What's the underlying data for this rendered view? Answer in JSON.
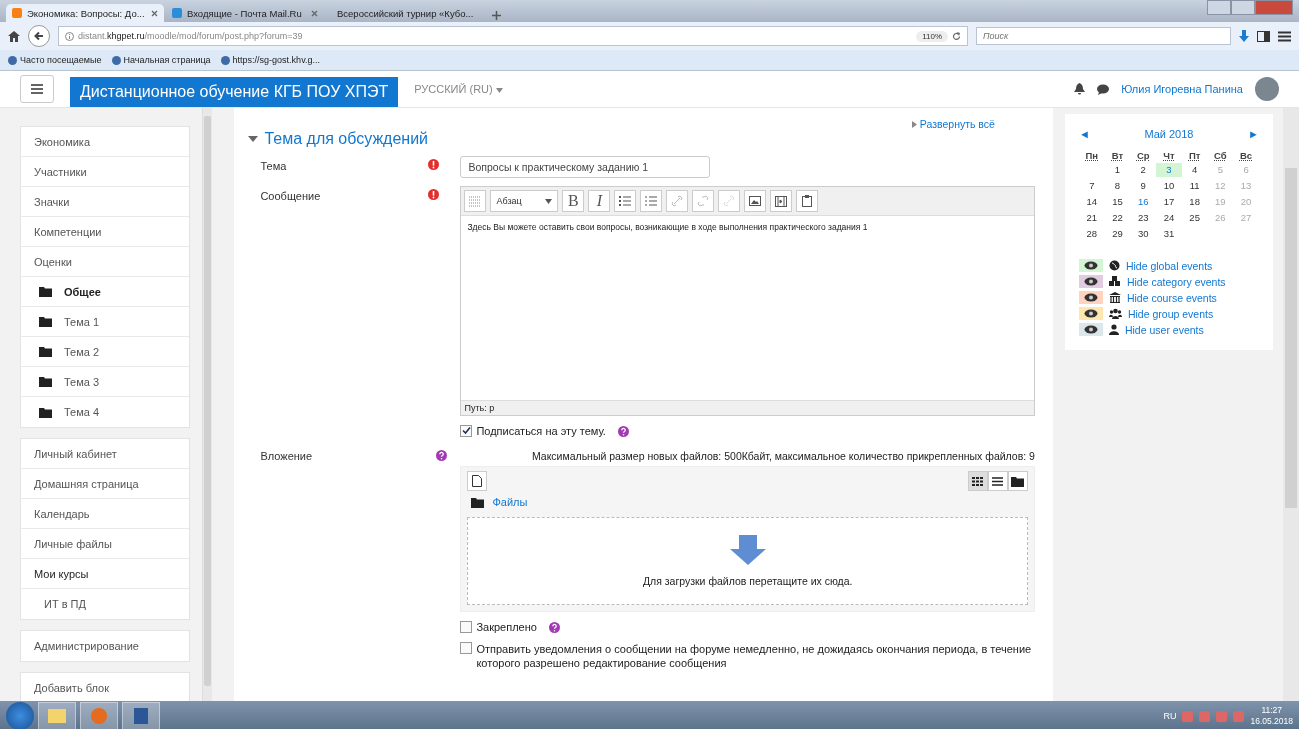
{
  "browser": {
    "tabs": [
      {
        "title": "Экономика: Вопросы: До...",
        "selected": true
      },
      {
        "title": "Входящие - Почта Mail.Ru",
        "selected": false
      },
      {
        "title": "Всероссийский турнир «Кубо...",
        "selected": false
      }
    ],
    "url_prefix": "distant.",
    "url_domain": "khgpet.ru",
    "url_path": "/moodle/mod/forum/post.php?forum=39",
    "zoom": "110%",
    "search_placeholder": "Поиск",
    "bookmarks": [
      "Часто посещаемые",
      "Начальная страница",
      "https://sg-gost.khv.g..."
    ]
  },
  "navbar": {
    "brand": "Дистанционное обучение КГБ ПОУ ХПЭТ",
    "language": "РУССКИЙ (RU)",
    "user": "Юлия Игоревна Панина"
  },
  "sidebar": {
    "cards": [
      {
        "items": [
          {
            "label": "Экономика",
            "kind": "link",
            "selected": false
          },
          {
            "label": "Участники",
            "kind": "link",
            "selected": false
          },
          {
            "label": "Значки",
            "kind": "link",
            "selected": false
          },
          {
            "label": "Компетенции",
            "kind": "link",
            "selected": false
          },
          {
            "label": "Оценки",
            "kind": "link",
            "selected": false
          },
          {
            "label": "Общее",
            "kind": "section",
            "selected": true
          },
          {
            "label": "Тема 1",
            "kind": "section",
            "selected": false
          },
          {
            "label": "Тема 2",
            "kind": "section",
            "selected": false
          },
          {
            "label": "Тема 3",
            "kind": "section",
            "selected": false
          },
          {
            "label": "Тема 4",
            "kind": "section",
            "selected": false
          }
        ]
      },
      {
        "items": [
          {
            "label": "Личный кабинет",
            "kind": "link",
            "selected": false
          },
          {
            "label": "Домашняя страница",
            "kind": "link",
            "selected": false
          },
          {
            "label": "Календарь",
            "kind": "link",
            "selected": false
          },
          {
            "label": "Личные файлы",
            "kind": "link",
            "selected": false
          },
          {
            "label": "Мои курсы",
            "kind": "heading",
            "selected": false
          },
          {
            "label": "ИТ в ПД",
            "kind": "child",
            "selected": false
          }
        ]
      },
      {
        "items": [
          {
            "label": "Администрирование",
            "kind": "link",
            "selected": false
          }
        ]
      },
      {
        "items": [
          {
            "label": "Добавить блок",
            "kind": "link",
            "selected": false
          }
        ]
      }
    ]
  },
  "form": {
    "expand_all": "Развернуть всё",
    "section_title": "Тема для обсуждений",
    "expanded": true,
    "subject": {
      "label": "Тема",
      "value": "Вопросы к практическому заданию 1"
    },
    "message": {
      "label": "Сообщение",
      "format": "Абзац",
      "bold": "B",
      "italic": "I",
      "text": "Здесь Вы можете оставить свои вопросы, возникающие в ходе выполнения практического задания 1",
      "path": "Путь: p"
    },
    "subscribe": {
      "label": "Подписаться на эту тему.",
      "checked": true
    },
    "attachment": {
      "label": "Вложение",
      "limits": "Максимальный размер новых файлов: 500Кбайт, максимальное количество прикрепленных файлов: 9",
      "folder": "Файлы",
      "drop_hint": "Для загрузки файлов перетащите их сюда."
    },
    "pinned": {
      "label": "Закреплено",
      "checked": false
    },
    "notify": {
      "label": "Отправить уведомления о сообщении на форуме немедленно, не дожидаясь окончания периода, в течение которого разрешено редактирование сообщения",
      "checked": false
    }
  },
  "calendar": {
    "month": "Май 2018",
    "prev": "◄",
    "next": "►",
    "weekdays": [
      "Пн",
      "Вт",
      "Ср",
      "Чт",
      "Пт",
      "Сб",
      "Вс"
    ],
    "weeks": [
      [
        {
          "day": "1",
          "event": false,
          "today": false
        },
        {
          "day": "2",
          "event": false,
          "today": false
        },
        {
          "day": "3",
          "event": true,
          "today": false
        },
        {
          "day": "4",
          "event": false,
          "today": false
        },
        {
          "day": "5",
          "event": false,
          "today": false
        },
        {
          "day": "6",
          "event": false,
          "today": false
        }
      ],
      [
        {
          "day": "7",
          "event": false,
          "today": false
        },
        {
          "day": "8",
          "event": false,
          "today": false
        },
        {
          "day": "9",
          "event": false,
          "today": false
        },
        {
          "day": "10",
          "event": false,
          "today": false
        },
        {
          "day": "11",
          "event": false,
          "today": false
        },
        {
          "day": "12",
          "event": false,
          "today": false
        },
        {
          "day": "13",
          "event": false,
          "today": false
        }
      ],
      [
        {
          "day": "14",
          "event": false,
          "today": false
        },
        {
          "day": "15",
          "event": false,
          "today": false
        },
        {
          "day": "16",
          "event": false,
          "today": true
        },
        {
          "day": "17",
          "event": false,
          "today": false
        },
        {
          "day": "18",
          "event": false,
          "today": false
        },
        {
          "day": "19",
          "event": false,
          "today": false
        },
        {
          "day": "20",
          "event": false,
          "today": false
        }
      ],
      [
        {
          "day": "21",
          "event": false,
          "today": false
        },
        {
          "day": "22",
          "event": false,
          "today": false
        },
        {
          "day": "23",
          "event": false,
          "today": false
        },
        {
          "day": "24",
          "event": false,
          "today": false
        },
        {
          "day": "25",
          "event": false,
          "today": false
        },
        {
          "day": "26",
          "event": false,
          "today": false
        },
        {
          "day": "27",
          "event": false,
          "today": false
        }
      ],
      [
        {
          "day": "28",
          "event": false,
          "today": false
        },
        {
          "day": "29",
          "event": false,
          "today": false
        },
        {
          "day": "30",
          "event": false,
          "today": false
        },
        {
          "day": "31",
          "event": false,
          "today": false
        }
      ]
    ],
    "filters": [
      {
        "label": "Hide global events",
        "kind": "global",
        "color": "#d3f5d3"
      },
      {
        "label": "Hide category events",
        "kind": "category",
        "color": "#e0cbe0"
      },
      {
        "label": "Hide course events",
        "kind": "course",
        "color": "#ffd3bd"
      },
      {
        "label": "Hide group events",
        "kind": "group",
        "color": "#fee7ae"
      },
      {
        "label": "Hide user events",
        "kind": "user",
        "color": "#dce7ec"
      }
    ]
  },
  "taskbar": {
    "language": "RU",
    "time": "11:27",
    "date": "16.05.2018"
  }
}
